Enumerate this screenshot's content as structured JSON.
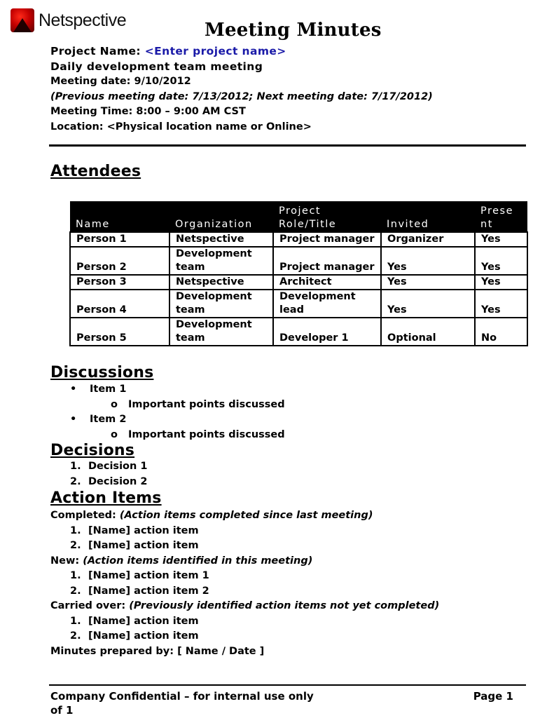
{
  "brand": {
    "name": "Netspective",
    "logo_icon": "netspective-logo-icon",
    "logo_color": "#c40000"
  },
  "document": {
    "title": "Meeting Minutes",
    "project_label": "Project Name: ",
    "project_value": "<Enter project name>",
    "project_value_color": "#1a1aa8",
    "meeting_name": "Daily development team meeting",
    "meeting_date": "Meeting date: 9/10/2012",
    "prev_next": "(Previous meeting date: 7/13/2012; Next meeting date: 7/17/2012)",
    "meeting_time": "Meeting Time: 8:00 – 9:00 AM CST",
    "location": "Location: <Physical location name or Online>"
  },
  "attendees": {
    "heading": "Attendees",
    "columns": [
      "Name",
      "Organization",
      "Project Role/Title",
      "Invited",
      "Present"
    ],
    "columns_display": [
      "Name",
      "Organization",
      "Project\nRole/Title",
      "Invited",
      "Prese\nnt"
    ],
    "rows": [
      {
        "name": "Person 1",
        "org": "Netspective",
        "role": "Project manager",
        "invited": "Organizer",
        "present": "Yes"
      },
      {
        "name": "Person 2",
        "org": "Development team",
        "role": "Project manager",
        "invited": "Yes",
        "present": "Yes"
      },
      {
        "name": "Person 3",
        "org": "Netspective",
        "role": "Architect",
        "invited": "Yes",
        "present": "Yes"
      },
      {
        "name": "Person 4",
        "org": "Development team",
        "role": "Development lead",
        "invited": "Yes",
        "present": "Yes"
      },
      {
        "name": "Person 5",
        "org": "Development team",
        "role": "Developer 1",
        "invited": "Optional",
        "present": "No"
      }
    ]
  },
  "discussions": {
    "heading": "Discussions",
    "items": [
      {
        "label": "Item 1",
        "sub": "Important points discussed"
      },
      {
        "label": "Item 2",
        "sub": "Important points discussed"
      }
    ]
  },
  "decisions": {
    "heading": "Decisions",
    "items": [
      "Decision 1",
      "Decision 2"
    ]
  },
  "action_items": {
    "heading": "Action Items",
    "groups": [
      {
        "label": "Completed:",
        "note": "(Action items completed since last meeting)",
        "items": [
          "[Name] action item",
          "[Name] action item"
        ]
      },
      {
        "label": "New:",
        "note": "(Action items identified in this meeting)",
        "items": [
          "[Name] action item 1",
          "[Name] action item 2"
        ]
      },
      {
        "label": "Carried over:",
        "note": "(Previously identified action items not yet completed)",
        "items": [
          "[Name] action item",
          "[Name] action item"
        ]
      }
    ],
    "prepared_by": "Minutes prepared by: [ Name / Date ]"
  },
  "footer": {
    "confidential": "Company Confidential – for internal use only",
    "page": "Page 1",
    "of": "of 1"
  }
}
